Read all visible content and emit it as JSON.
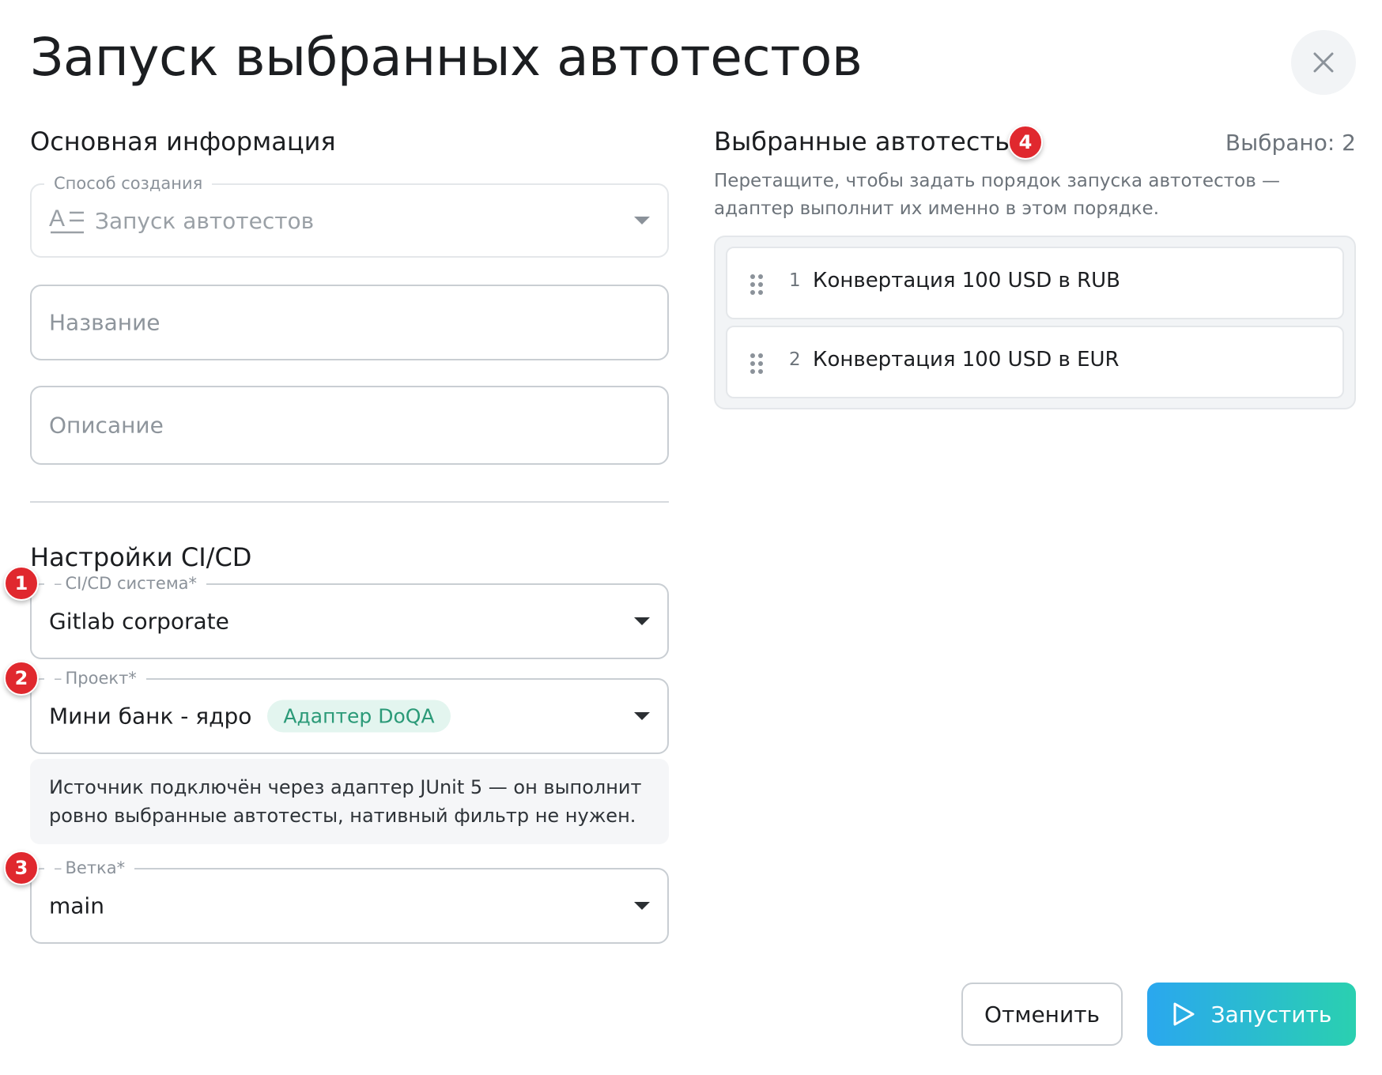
{
  "dialog": {
    "title": "Запуск выбранных автотестов"
  },
  "basic": {
    "section_title": "Основная информация",
    "creation_method": {
      "label": "Способ создания",
      "value": "Запуск автотестов"
    },
    "name_placeholder": "Название",
    "description_placeholder": "Описание"
  },
  "cicd": {
    "section_title": "Настройки CI/CD",
    "system": {
      "label": "CI/CD система*",
      "value": "Gitlab corporate",
      "marker": "1"
    },
    "project": {
      "label": "Проект*",
      "value": "Мини банк - ядро",
      "chip": "Адаптер DoQA",
      "marker": "2"
    },
    "info": "Источник подключён через адаптер JUnit 5 — он выполнит ровно выбранные автотесты, нативный фильтр не нужен.",
    "branch": {
      "label": "Ветка*",
      "value": "main",
      "marker": "3"
    }
  },
  "selected": {
    "section_title": "Выбранные автотесты",
    "marker": "4",
    "count_text": "Выбрано: 2",
    "hint": "Перетащите, чтобы задать порядок запуска автотестов — адаптер выполнит их именно в этом порядке.",
    "items": [
      {
        "index": "1",
        "name": "Конвертация 100 USD в RUB"
      },
      {
        "index": "2",
        "name": "Конвертация 100 USD в EUR"
      }
    ]
  },
  "actions": {
    "cancel": "Отменить",
    "run": "Запустить"
  },
  "colors": {
    "marker": "#e0282e",
    "chip_bg": "#e3f5ef",
    "chip_text": "#2b9a78",
    "run_gradient_start": "#2aa7ef",
    "run_gradient_end": "#2ad0b0"
  },
  "icons": {
    "close": "close-icon",
    "text_format": "text-format-icon",
    "dropdown": "chevron-down-icon",
    "drag": "drag-handle-icon",
    "run": "play-icon"
  }
}
